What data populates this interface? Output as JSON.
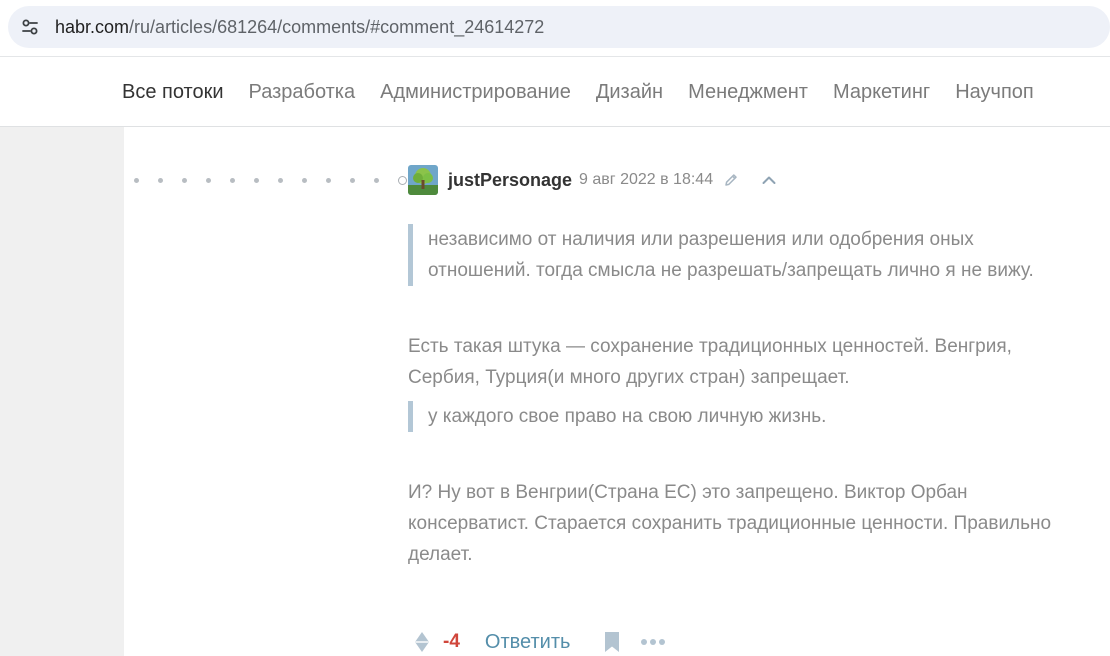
{
  "browser": {
    "url_host": "habr.com",
    "url_path": "/ru/articles/681264/comments/#comment_24614272",
    "site_info_icon": "tune-icon"
  },
  "nav": {
    "items": [
      {
        "label": "Все потоки",
        "active": true
      },
      {
        "label": "Разработка",
        "active": false
      },
      {
        "label": "Администрирование",
        "active": false
      },
      {
        "label": "Дизайн",
        "active": false
      },
      {
        "label": "Менеджмент",
        "active": false
      },
      {
        "label": "Маркетинг",
        "active": false
      },
      {
        "label": "Научпоп",
        "active": false
      }
    ]
  },
  "comment": {
    "author": "justPersonage",
    "timestamp": "9 авг 2022 в 18:44",
    "thread_depth": 11,
    "quote_1": "независимо от наличия или разрешения или одобрения оных отношений. тогда смысла не разрешать/запрещать лично я не вижу.",
    "paragraph_1": "Есть такая штука — сохранение традиционных ценностей. Венгрия, Сербия, Турция(и много других стран) запрещает.",
    "quote_2": "у каждого свое право на свою личную жизнь.",
    "paragraph_2": "И? Ну вот в Венгрии(Страна ЕС) это запрещено. Виктор Орбан консерватист. Старается сохранить традиционные ценности. Правильно делает.",
    "score": "-4",
    "reply_label": "Ответить"
  },
  "colors": {
    "score_negative": "#d0463b",
    "reply_link": "#548eaa",
    "quote_bar": "#b3c7d6",
    "body_text": "#8a8a8a"
  }
}
